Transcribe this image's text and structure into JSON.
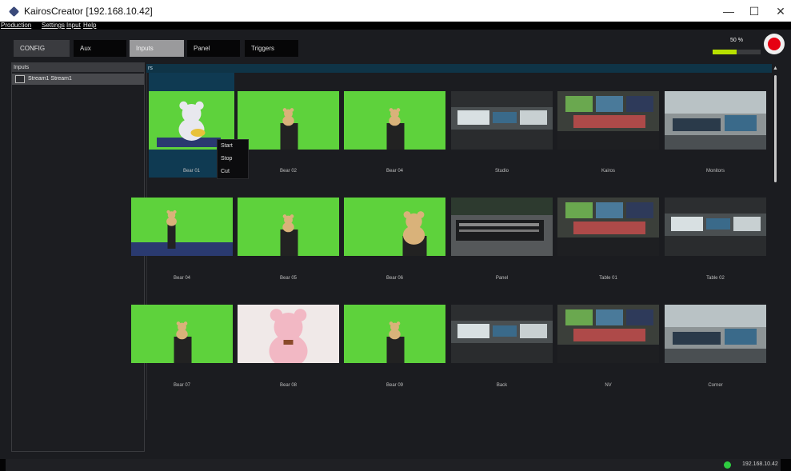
{
  "window": {
    "title": "KairosCreator [192.168.10.42]",
    "controls": {
      "minimize": "—",
      "maximize": "☐",
      "close": "✕"
    }
  },
  "menu": [
    {
      "label": "Production"
    },
    {
      "label": "Settings"
    },
    {
      "label": "Input"
    },
    {
      "label": "Help"
    }
  ],
  "toolbar": {
    "buttons": [
      {
        "label": "CONFIG"
      },
      {
        "label": "Aux"
      },
      {
        "label": "Inputs",
        "selected": true
      },
      {
        "label": "Panel"
      },
      {
        "label": "Triggers"
      }
    ],
    "level_percent_label": "50 %",
    "level_percent": 50
  },
  "left_panel": {
    "header": "Inputs",
    "items": [
      {
        "label": "Stream1  Stream1"
      }
    ]
  },
  "grid": {
    "header": "rs",
    "tiles": [
      {
        "label": "Bear 01",
        "scene": "bear-white",
        "selected": true
      },
      {
        "label": "Bear 02",
        "scene": "bear-box"
      },
      {
        "label": "Bear 04",
        "scene": "bear-box"
      },
      {
        "label": "Studio",
        "scene": "studio"
      },
      {
        "label": "Kairos",
        "scene": "monitors"
      },
      {
        "label": "Monitors",
        "scene": "studio-light"
      },
      {
        "label": "Bear 04",
        "scene": "bear-stand"
      },
      {
        "label": "Bear 05",
        "scene": "bear-box"
      },
      {
        "label": "Bear 06",
        "scene": "bear-big"
      },
      {
        "label": "Panel",
        "scene": "panel"
      },
      {
        "label": "Table 01",
        "scene": "monitors"
      },
      {
        "label": "Table 02",
        "scene": "studio"
      },
      {
        "label": "Bear 07",
        "scene": "bear-box"
      },
      {
        "label": "Bear 08",
        "scene": "bear-pink"
      },
      {
        "label": "Bear 09",
        "scene": "bear-box"
      },
      {
        "label": "Back",
        "scene": "studio"
      },
      {
        "label": "NV",
        "scene": "monitors"
      },
      {
        "label": "Corner",
        "scene": "studio-light"
      }
    ]
  },
  "context_menu": {
    "items": [
      {
        "label": "Start"
      },
      {
        "label": "Stop"
      },
      {
        "label": "Cut"
      }
    ]
  },
  "status": {
    "ip": "192.168.10.42",
    "connection": "connected"
  },
  "colors": {
    "background": "#1b1c20",
    "accent_green": "#b8e000",
    "record_red": "#e60012",
    "chroma_green": "#5ed23c",
    "selection_blue": "#0f3a52"
  }
}
